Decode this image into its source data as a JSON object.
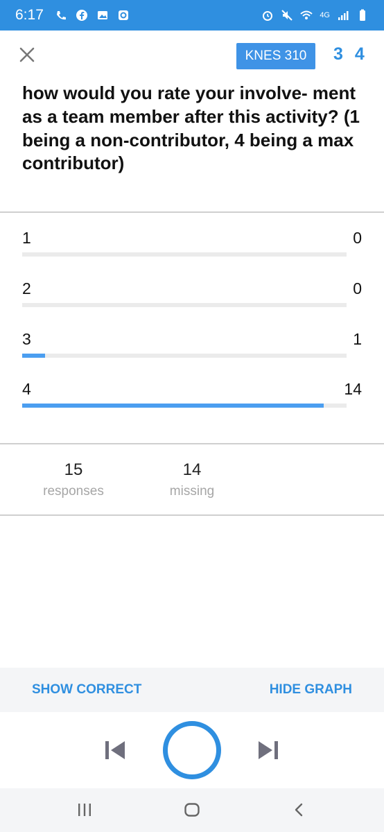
{
  "status_bar": {
    "time": "6:17",
    "left_icons": [
      "wifi-calling-icon",
      "facebook-icon",
      "gallery-icon",
      "app-icon"
    ],
    "right_icons": [
      "alarm-icon",
      "mute-icon",
      "wifi-icon",
      "lte-icon",
      "signal-icon",
      "battery-icon"
    ],
    "network_label": "4G"
  },
  "header": {
    "course": "KNES 310",
    "counter": "3 4"
  },
  "question": "how would you rate your involve- ment as a team member after this activity? (1 being a non-contributor, 4 being a max contributor)",
  "results": [
    {
      "label": "1",
      "count": "0",
      "fraction": 0
    },
    {
      "label": "2",
      "count": "0",
      "fraction": 0
    },
    {
      "label": "3",
      "count": "1",
      "fraction": 0.07
    },
    {
      "label": "4",
      "count": "14",
      "fraction": 0.93
    }
  ],
  "stats": {
    "responses_value": "15",
    "responses_label": "responses",
    "missing_value": "14",
    "missing_label": "missing"
  },
  "actions": {
    "show_correct": "SHOW CORRECT",
    "hide_graph": "HIDE GRAPH"
  },
  "colors": {
    "accent": "#2f8fe0",
    "bar_fill": "#4b9ef0",
    "bar_track": "#ebebeb"
  }
}
